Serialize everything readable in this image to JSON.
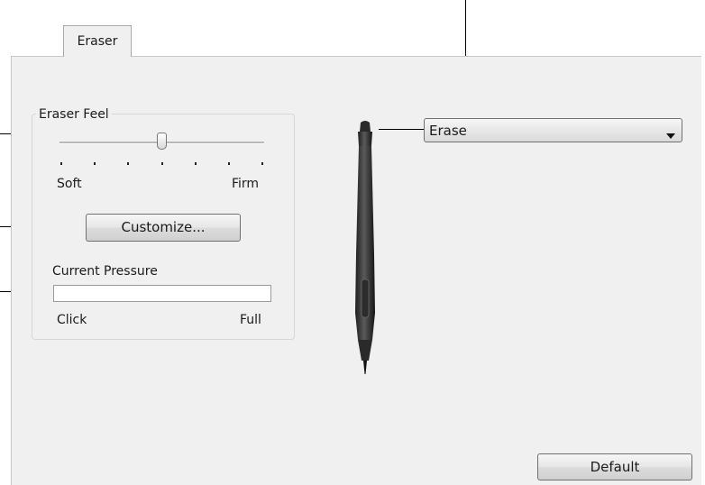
{
  "tabs": [
    {
      "label": "Eraser",
      "selected": true
    }
  ],
  "eraser_feel": {
    "title": "Eraser Feel",
    "min_label": "Soft",
    "max_label": "Firm",
    "tick_count": 7,
    "selected_tick": 3,
    "customize_label": "Customize..."
  },
  "current_pressure": {
    "title": "Current Pressure",
    "min_label": "Click",
    "max_label": "Full",
    "level": 0
  },
  "eraser_function": {
    "selected": "Erase"
  },
  "default_button": {
    "label": "Default"
  },
  "icons": {
    "pen": "pen-icon",
    "dropdown_arrow": "chevron-down-icon"
  },
  "colors": {
    "panel_bg": "#f0f0f0",
    "pen_body": "#3a3a3a",
    "callout_lines": "#000000"
  }
}
